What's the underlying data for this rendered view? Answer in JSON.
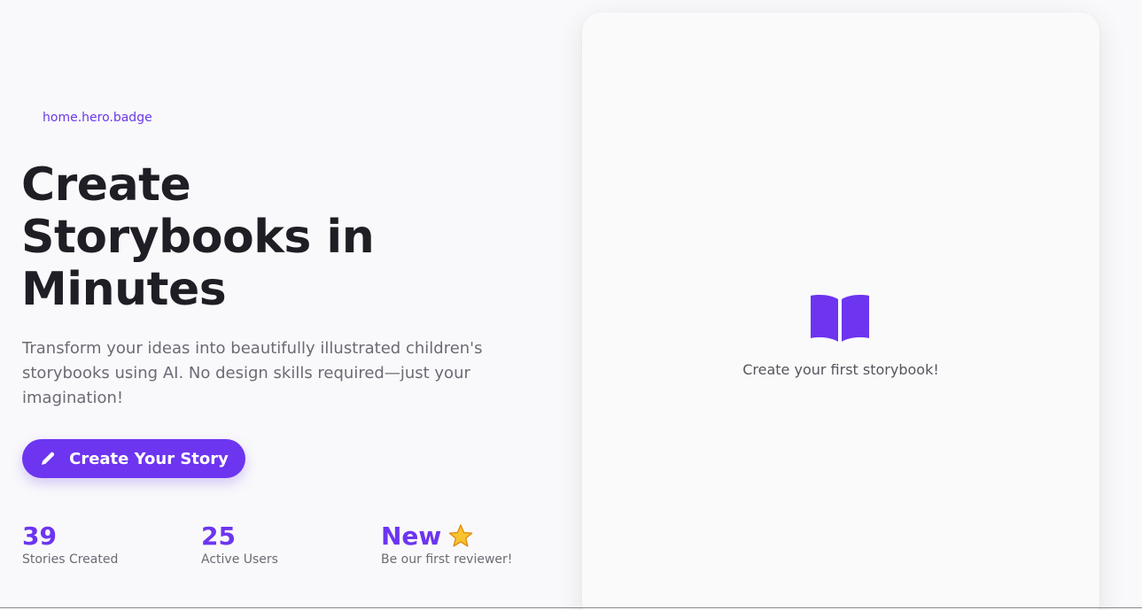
{
  "hero": {
    "badge": "home.hero.badge",
    "title": "Create Storybooks in Minutes",
    "subtitle": "Transform your ideas into beautifully illustrated children's storybooks using AI. No design skills required—just your imagination!",
    "cta_label": "Create Your Story",
    "cta_icon": "pencil-icon"
  },
  "stats": [
    {
      "value": "39",
      "label": "Stories Created"
    },
    {
      "value": "25",
      "label": "Active Users"
    },
    {
      "value": "New",
      "label": "Be our first reviewer!",
      "icon": "star-icon"
    }
  ],
  "preview": {
    "icon": "open-book-icon",
    "text": "Create your first storybook!"
  },
  "colors": {
    "accent": "#6d35f0",
    "text_dark": "#1e1e24",
    "text_muted": "#6b6b75",
    "background": "#f9f9fb",
    "star": "#f5b72a"
  }
}
